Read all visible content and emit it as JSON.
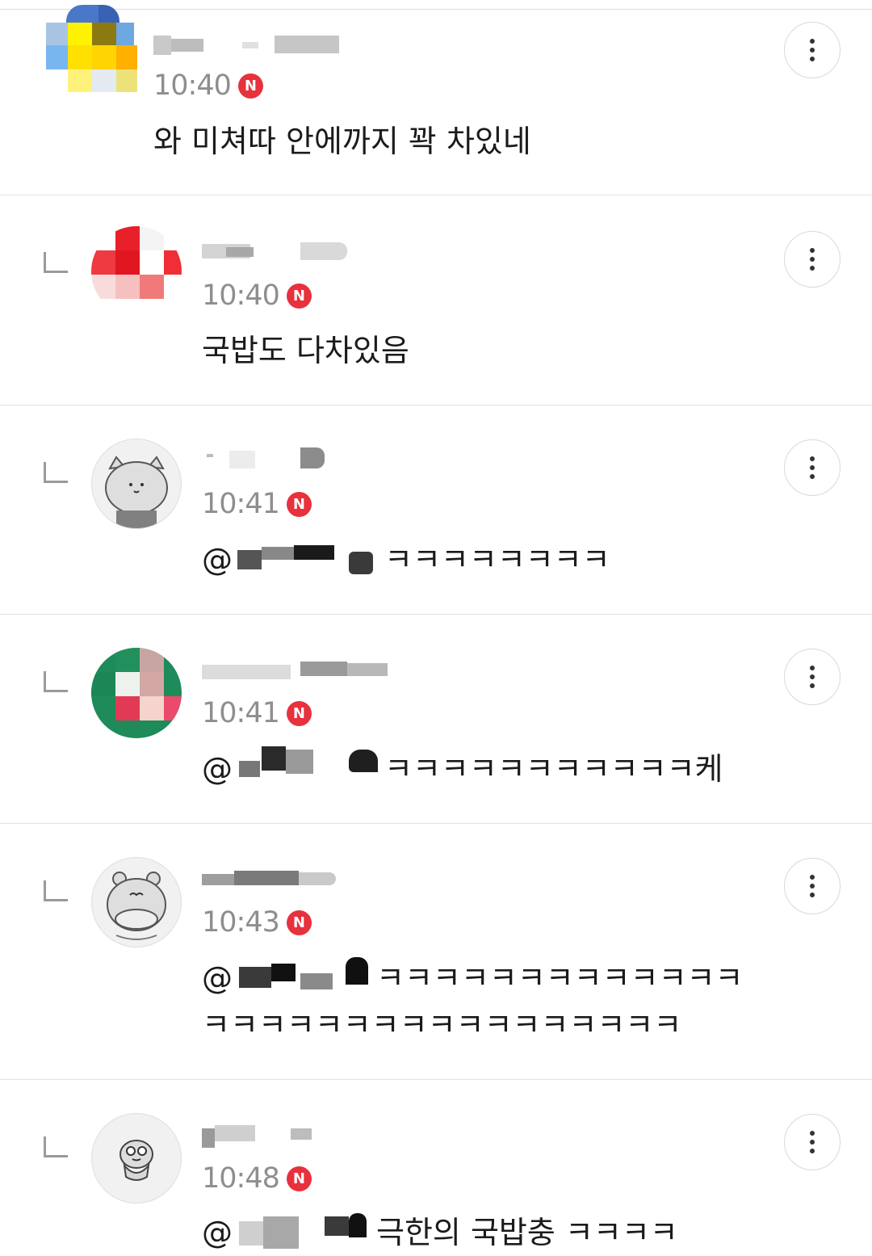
{
  "comments": [
    {
      "nickname": "",
      "time": "10:40",
      "new_badge": "N",
      "text": "와 미쳐따 안에까지 꽉 차있네"
    },
    {
      "nickname": "",
      "time": "10:40",
      "new_badge": "N",
      "text": "국밥도 다차있음"
    },
    {
      "nickname": "",
      "time": "10:41",
      "new_badge": "N",
      "mention": "@",
      "text": "ㅋㅋㅋㅋㅋㅋㅋㅋ"
    },
    {
      "nickname": "",
      "time": "10:41",
      "new_badge": "N",
      "mention": "@",
      "text": "ㅋㅋㅋㅋㅋㅋㅋㅋㅋㅋㅋ케"
    },
    {
      "nickname": "",
      "time": "10:43",
      "new_badge": "N",
      "mention": "@",
      "text": "ㅋㅋㅋㅋㅋㅋㅋㅋㅋㅋㅋㅋㅋ",
      "text2": "ㅋㅋㅋㅋㅋㅋㅋㅋㅋㅋㅋㅋㅋㅋㅋㅋㅋ"
    },
    {
      "nickname": "",
      "time": "10:48",
      "new_badge": "N",
      "mention": "@",
      "text": "극한의 국밥충 ㅋㅋㅋㅋ"
    }
  ],
  "colors": {
    "badge": "#e7313d",
    "time": "#8e8e8e",
    "text": "#1b1b1b",
    "divider": "#e3e3e3"
  },
  "icons": {
    "more": "more-vertical-icon",
    "reply": "reply-arrow-icon",
    "new": "new-badge-icon"
  }
}
